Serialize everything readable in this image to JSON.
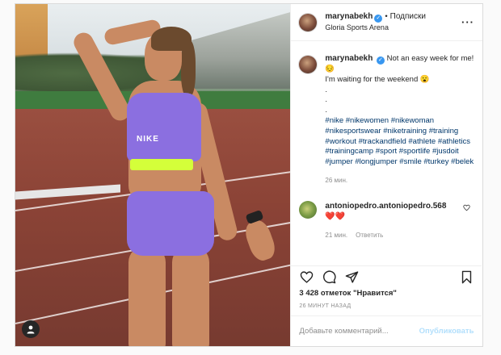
{
  "post": {
    "author": {
      "username": "marynabekh",
      "verified": true,
      "follow_label": "Подписки",
      "location": "Gloria Sports Arena"
    },
    "more_icon": "more-horizontal-icon",
    "caption": {
      "username": "marynabekh",
      "line1": "Not an easy week for me! 😔",
      "line2": "I'm waiting for the weekend 😮",
      "dots": [
        ".",
        ".",
        "."
      ],
      "hashtags": "#nike #nikewomen #nikewoman #nikesportswear #niketraining #training #workout #trackandfield #athlete #athletics #trainingcamp #sport #sportlife #jusdoit #jumper #longjumper #smile #turkey #belek",
      "time": "26 мин."
    },
    "comments": [
      {
        "username": "antoniopedro.antoniopedro.568",
        "text": "❤️❤️",
        "time": "21 мин.",
        "reply_label": "Ответить"
      }
    ],
    "actions": {
      "like_icon": "heart-icon",
      "comment_icon": "comment-icon",
      "share_icon": "paper-plane-icon",
      "save_icon": "bookmark-icon"
    },
    "likes_text": "3 428 отметок \"Нравится\"",
    "posted_ago": "26 МИНУТ НАЗАД",
    "add_comment": {
      "placeholder": "Добавьте комментарий...",
      "publish_label": "Опубликовать"
    },
    "photo_text": "NIKE"
  },
  "colors": {
    "verified": "#3897f0",
    "link": "#00376b",
    "muted": "#8e8e8e",
    "publish_disabled": "#b2dffc",
    "heart": "#ed4956"
  }
}
